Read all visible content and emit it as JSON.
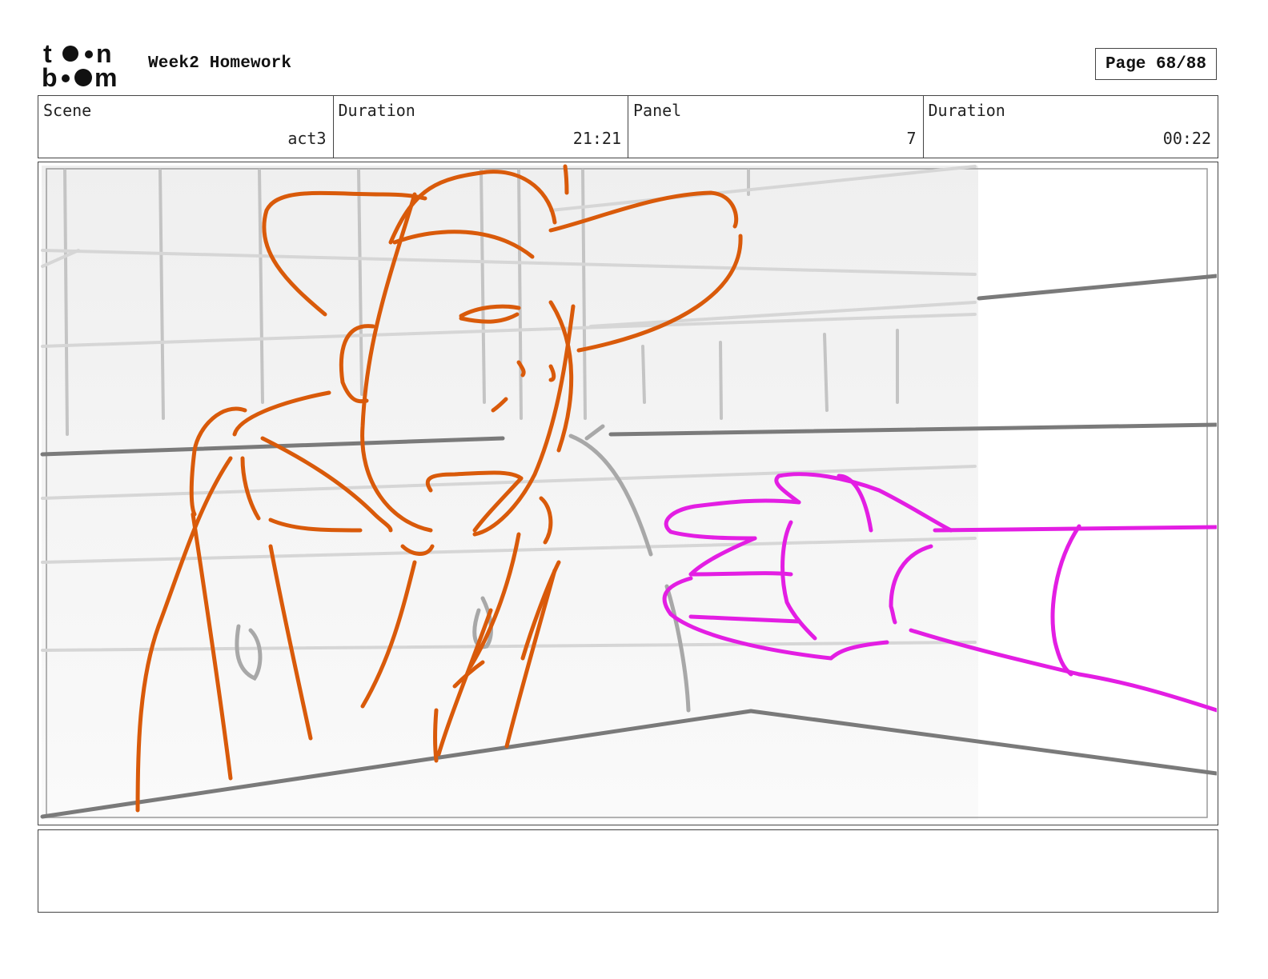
{
  "logo": {
    "line1": "toon",
    "line2": "boom"
  },
  "header": {
    "title": "Week2 Homework",
    "page": "Page 68/88"
  },
  "info": [
    {
      "label": "Scene",
      "value": "act3"
    },
    {
      "label": "Duration",
      "value": "21:21"
    },
    {
      "label": "Panel",
      "value": "7"
    },
    {
      "label": "Duration",
      "value": "00:22"
    }
  ],
  "panel": {
    "description": "",
    "colors": {
      "character": "#d95a0a",
      "hand": "#e31ee3",
      "background_lines": "#b5b5b5",
      "background_dark": "#777777"
    }
  },
  "notes": {
    "text": ""
  }
}
